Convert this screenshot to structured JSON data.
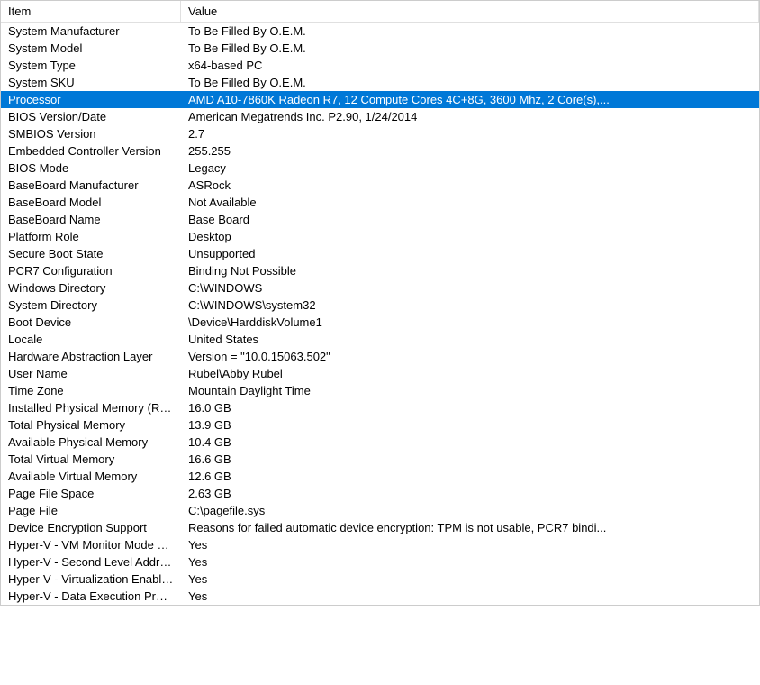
{
  "header": {
    "item": "Item",
    "value": "Value"
  },
  "rows": [
    {
      "item": "System Manufacturer",
      "value": "To Be Filled By O.E.M.",
      "selected": false
    },
    {
      "item": "System Model",
      "value": "To Be Filled By O.E.M.",
      "selected": false
    },
    {
      "item": "System Type",
      "value": "x64-based PC",
      "selected": false
    },
    {
      "item": "System SKU",
      "value": "To Be Filled By O.E.M.",
      "selected": false
    },
    {
      "item": "Processor",
      "value": "AMD A10-7860K Radeon R7, 12 Compute Cores 4C+8G, 3600 Mhz, 2 Core(s),...",
      "selected": true
    },
    {
      "item": "BIOS Version/Date",
      "value": "American Megatrends Inc. P2.90, 1/24/2014",
      "selected": false
    },
    {
      "item": "SMBIOS Version",
      "value": "2.7",
      "selected": false
    },
    {
      "item": "Embedded Controller Version",
      "value": "255.255",
      "selected": false
    },
    {
      "item": "BIOS Mode",
      "value": "Legacy",
      "selected": false
    },
    {
      "item": "BaseBoard Manufacturer",
      "value": "ASRock",
      "selected": false
    },
    {
      "item": "BaseBoard Model",
      "value": "Not Available",
      "selected": false
    },
    {
      "item": "BaseBoard Name",
      "value": "Base Board",
      "selected": false
    },
    {
      "item": "Platform Role",
      "value": "Desktop",
      "selected": false
    },
    {
      "item": "Secure Boot State",
      "value": "Unsupported",
      "selected": false
    },
    {
      "item": "PCR7 Configuration",
      "value": "Binding Not Possible",
      "selected": false
    },
    {
      "item": "Windows Directory",
      "value": "C:\\WINDOWS",
      "selected": false
    },
    {
      "item": "System Directory",
      "value": "C:\\WINDOWS\\system32",
      "selected": false
    },
    {
      "item": "Boot Device",
      "value": "\\Device\\HarddiskVolume1",
      "selected": false
    },
    {
      "item": "Locale",
      "value": "United States",
      "selected": false
    },
    {
      "item": "Hardware Abstraction Layer",
      "value": "Version = \"10.0.15063.502\"",
      "selected": false
    },
    {
      "item": "User Name",
      "value": "Rubel\\Abby Rubel",
      "selected": false
    },
    {
      "item": "Time Zone",
      "value": "Mountain Daylight Time",
      "selected": false
    },
    {
      "item": "Installed Physical Memory (RAM)",
      "value": "16.0 GB",
      "selected": false
    },
    {
      "item": "Total Physical Memory",
      "value": "13.9 GB",
      "selected": false
    },
    {
      "item": "Available Physical Memory",
      "value": "10.4 GB",
      "selected": false
    },
    {
      "item": "Total Virtual Memory",
      "value": "16.6 GB",
      "selected": false
    },
    {
      "item": "Available Virtual Memory",
      "value": "12.6 GB",
      "selected": false
    },
    {
      "item": "Page File Space",
      "value": "2.63 GB",
      "selected": false
    },
    {
      "item": "Page File",
      "value": "C:\\pagefile.sys",
      "selected": false
    },
    {
      "item": "Device Encryption Support",
      "value": "Reasons for failed automatic device encryption: TPM is not usable, PCR7 bindi...",
      "selected": false
    },
    {
      "item": "Hyper-V - VM Monitor Mode E...",
      "value": "Yes",
      "selected": false
    },
    {
      "item": "Hyper-V - Second Level Addres...",
      "value": "Yes",
      "selected": false
    },
    {
      "item": "Hyper-V - Virtualization Enable...",
      "value": "Yes",
      "selected": false
    },
    {
      "item": "Hyper-V - Data Execution Prote...",
      "value": "Yes",
      "selected": false
    }
  ]
}
